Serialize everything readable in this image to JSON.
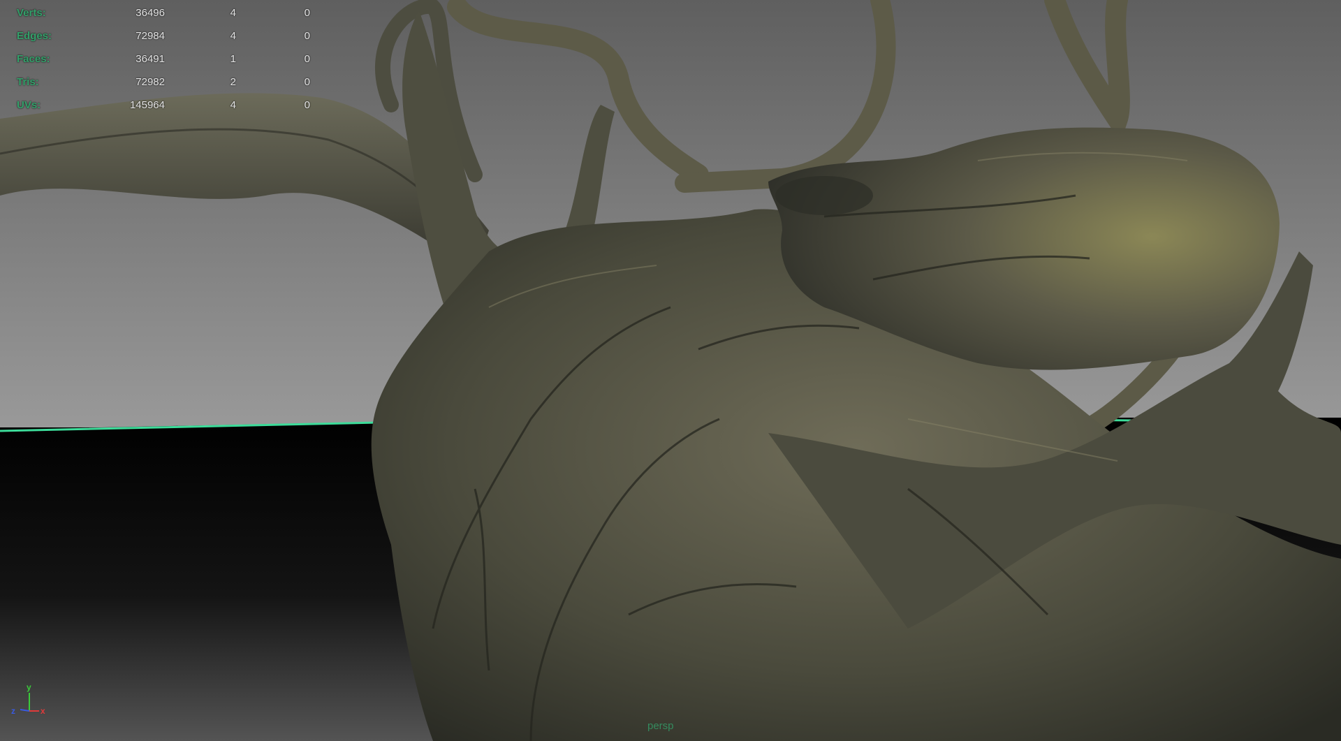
{
  "viewport": {
    "camera": "persp",
    "horizon_color": "#3ddc9a",
    "hud_label_color": "#33a06a"
  },
  "poly_count": [
    {
      "label": "Verts:",
      "c1": "36496",
      "c2": "4",
      "c3": "0"
    },
    {
      "label": "Edges:",
      "c1": "72984",
      "c2": "4",
      "c3": "0"
    },
    {
      "label": "Faces:",
      "c1": "36491",
      "c2": "1",
      "c3": "0"
    },
    {
      "label": "Tris:",
      "c1": "72982",
      "c2": "2",
      "c3": "0"
    },
    {
      "label": "UVs:",
      "c1": "145964",
      "c2": "4",
      "c3": "0"
    }
  ],
  "axis_gizmo": {
    "x_label": "x",
    "y_label": "y",
    "z_label": "z",
    "x_color": "#e03a3a",
    "y_color": "#3acc3a",
    "z_color": "#3a5ae0"
  }
}
